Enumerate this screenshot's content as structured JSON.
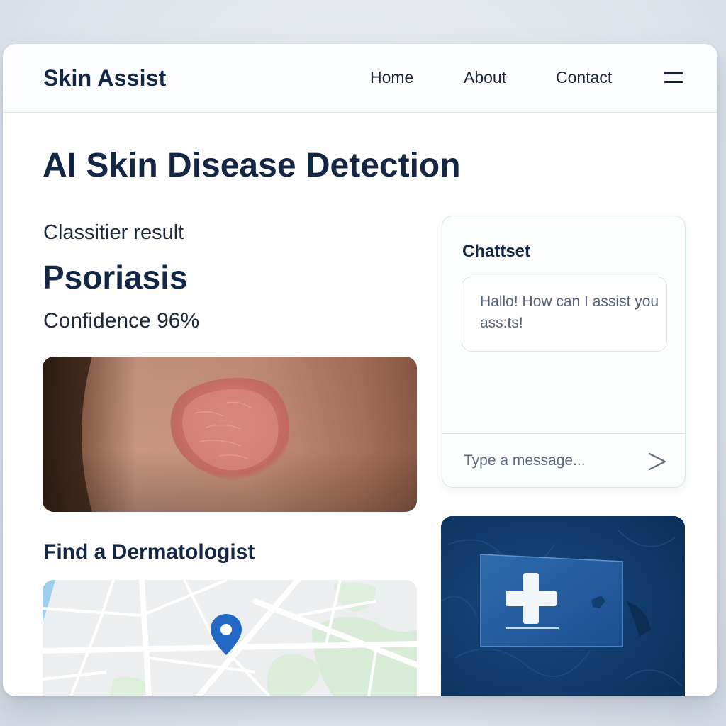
{
  "navbar": {
    "brand": "Skin Assist",
    "links": [
      "Home",
      "About",
      "Contact"
    ],
    "menu_icon": "hamburger-menu-icon"
  },
  "page": {
    "title": "AI Skin Disease Detection"
  },
  "result": {
    "label": "Classitier result",
    "name": "Psoriasis",
    "confidence": "Confidence 96%"
  },
  "dermatologist": {
    "title": "Find a Dermatologist",
    "map_pin_icon": "map-pin-icon"
  },
  "chat": {
    "title": "Chattset",
    "message": "Hallo! How can I assist you ass:ts!",
    "input_placeholder": "Type a message...",
    "send_icon": "send-chevron-icon"
  },
  "health_card": {
    "icon": "medical-cross-icon"
  },
  "colors": {
    "brand_navy": "#132744",
    "card_blue": "#0f3766",
    "pin_blue": "#2368c4"
  }
}
